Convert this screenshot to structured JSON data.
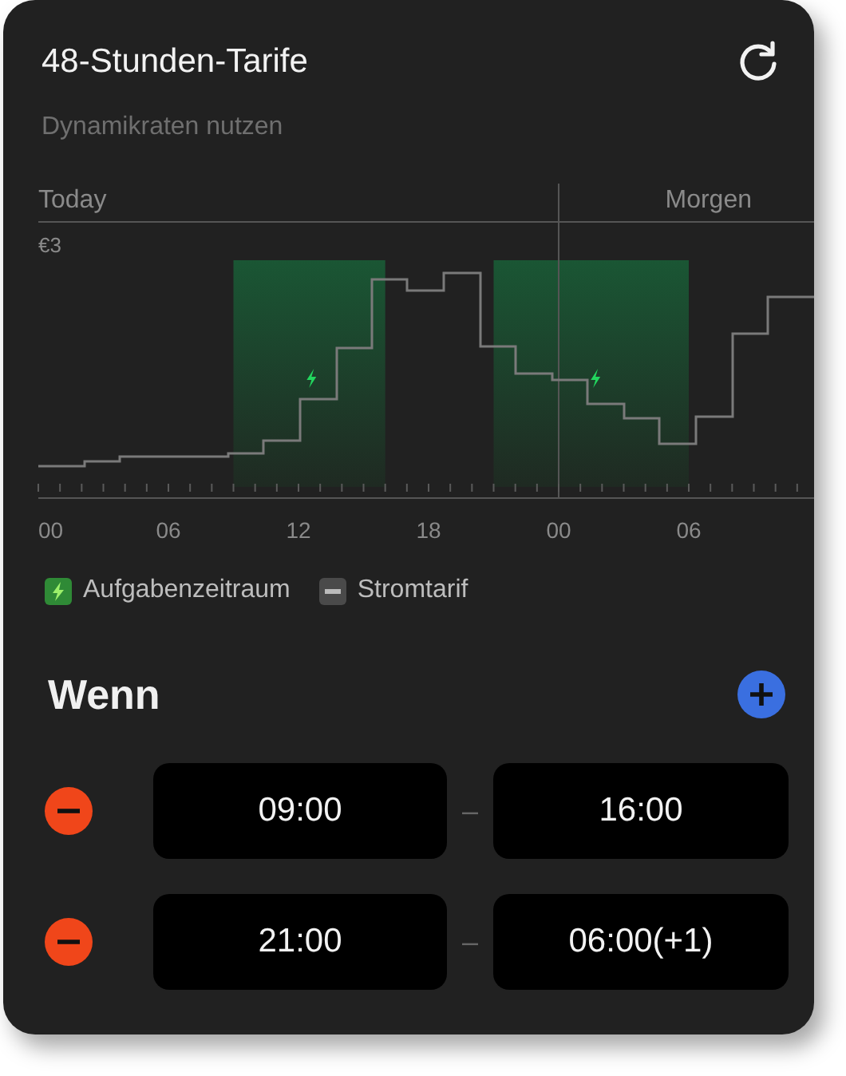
{
  "title": "48-Stunden-Tarife",
  "subtitle": "Dynamikraten nutzen",
  "chart": {
    "day_labels": [
      "Today",
      "Morgen"
    ],
    "y_label": "€3",
    "x_labels": [
      "00",
      "06",
      "12",
      "18",
      "00",
      "06"
    ]
  },
  "legend": [
    {
      "kind": "task",
      "label": "Aufgabenzeitraum"
    },
    {
      "kind": "tariff",
      "label": "Stromtarif"
    }
  ],
  "section_title": "Wenn",
  "rows": [
    {
      "start": "09:00",
      "separator": "–",
      "end": "16:00"
    },
    {
      "start": "21:00",
      "separator": "–",
      "end": "06:00(+1)"
    }
  ]
}
